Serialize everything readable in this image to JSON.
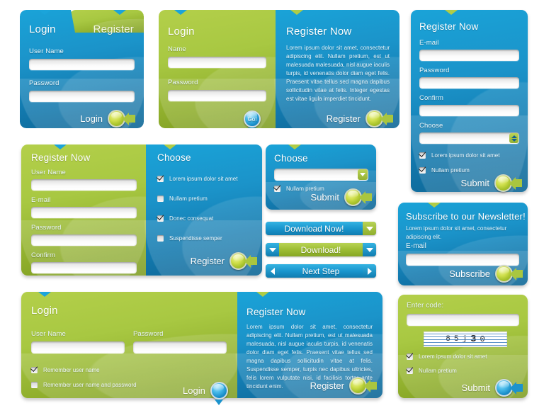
{
  "colors": {
    "blue": "#1793cc",
    "green": "#a8c842",
    "yellow_ball": "#cede4a",
    "blue_ball": "#2ba3dc"
  },
  "panel_login_tabs": {
    "tab_active": "Login",
    "tab_inactive": "Register",
    "username_label": "User Name",
    "username_value": "",
    "password_label": "Password",
    "password_value": "",
    "submit_label": "Login"
  },
  "panel_login_register": {
    "left_title": "Login",
    "name_label": "Name",
    "name_value": "",
    "password_label": "Password",
    "password_value": "",
    "go_label": "Go!",
    "right_title": "Register Now",
    "right_body": "Lorem ipsum dolor sit amet, consectetur adipiscing elit. Nullam pretium, est ut malesuada malesuada, nisl augue iaculis turpis, id venenatis dolor diam eget felis. Praesent vitae tellus sed magna dapibus sollicitudin vitae at felis. Integer egestas est vitae ligula imperdiet tincidunt.",
    "right_submit": "Register"
  },
  "panel_register_now": {
    "title": "Register Now",
    "email_label": "E-mail",
    "email_value": "",
    "password_label": "Password",
    "password_value": "",
    "confirm_label": "Confirm",
    "confirm_value": "",
    "choose_label": "Choose",
    "choose_value": "",
    "checkboxes": [
      {
        "label": "Lorem ipsum dolor sit amet",
        "checked": true
      },
      {
        "label": "Nullam pretium",
        "checked": true
      }
    ],
    "submit_label": "Submit"
  },
  "panel_register_choose": {
    "left_title": "Register Now",
    "username_label": "User Name",
    "username_value": "",
    "email_label": "E-mail",
    "email_value": "",
    "password_label": "Password",
    "password_value": "",
    "confirm_label": "Confirm",
    "confirm_value": "",
    "right_title": "Choose",
    "checkboxes": [
      {
        "label": "Lorem ipsum dolor sit amet",
        "checked": true
      },
      {
        "label": "Nullam pretium",
        "checked": false
      },
      {
        "label": "Donec consequat",
        "checked": true
      },
      {
        "label": "Suspendisse semper",
        "checked": false
      }
    ],
    "submit_label": "Register"
  },
  "panel_choose_small": {
    "title": "Choose",
    "select_value": "",
    "checkbox_label": "Nullam pretium",
    "checkbox_checked": true,
    "submit_label": "Submit"
  },
  "action_buttons": [
    {
      "label": "Download Now!",
      "style": "blue",
      "left_arrow": false,
      "right_arrow": "down-green"
    },
    {
      "label": "Download!",
      "style": "green",
      "left_arrow": "down-blue",
      "right_arrow": "down-blue"
    },
    {
      "label": "Next Step",
      "style": "blue",
      "left_arrow": "left-blue",
      "right_arrow": "right-blue"
    }
  ],
  "panel_newsletter": {
    "title": "Subscribe to our Newsletter!",
    "body": "Lorem ipsum dolor sit amet, consectetur adipiscing elit.",
    "email_label": "E-mail",
    "email_value": "",
    "submit_label": "Subscribe"
  },
  "panel_login_wide": {
    "title": "Login",
    "username_label": "User Name",
    "username_value": "",
    "password_label": "Password",
    "password_value": "",
    "checkboxes": [
      {
        "label": "Remember user name",
        "checked": true
      },
      {
        "label": "Remember user name and password",
        "checked": false
      }
    ],
    "submit_label": "Login"
  },
  "panel_register_text": {
    "title": "Register Now",
    "body": "Lorem ipsum dolor sit amet, consectetur adipiscing elit. Nullam pretium, est ut malesuada malesuada, nisl augue iaculis turpis, id venenatis dolor diam eget felis. Praesent vitae tellus sed magna dapibus sollicitudin vitae at felis. Suspendisse semper, turpis nec dapibus ultricies, felis lorem vulputate nisi, id facilisis tortor ante tincidunt enim.",
    "submit_label": "Register"
  },
  "panel_captcha": {
    "title": "Enter code:",
    "code_value": "",
    "captcha_chars": [
      "8",
      "5",
      "j",
      "3",
      "0"
    ],
    "checkboxes": [
      {
        "label": "Lorem ipsum dolor sit amet",
        "checked": true
      },
      {
        "label": "Nullam pretium",
        "checked": true
      }
    ],
    "submit_label": "Submit"
  }
}
